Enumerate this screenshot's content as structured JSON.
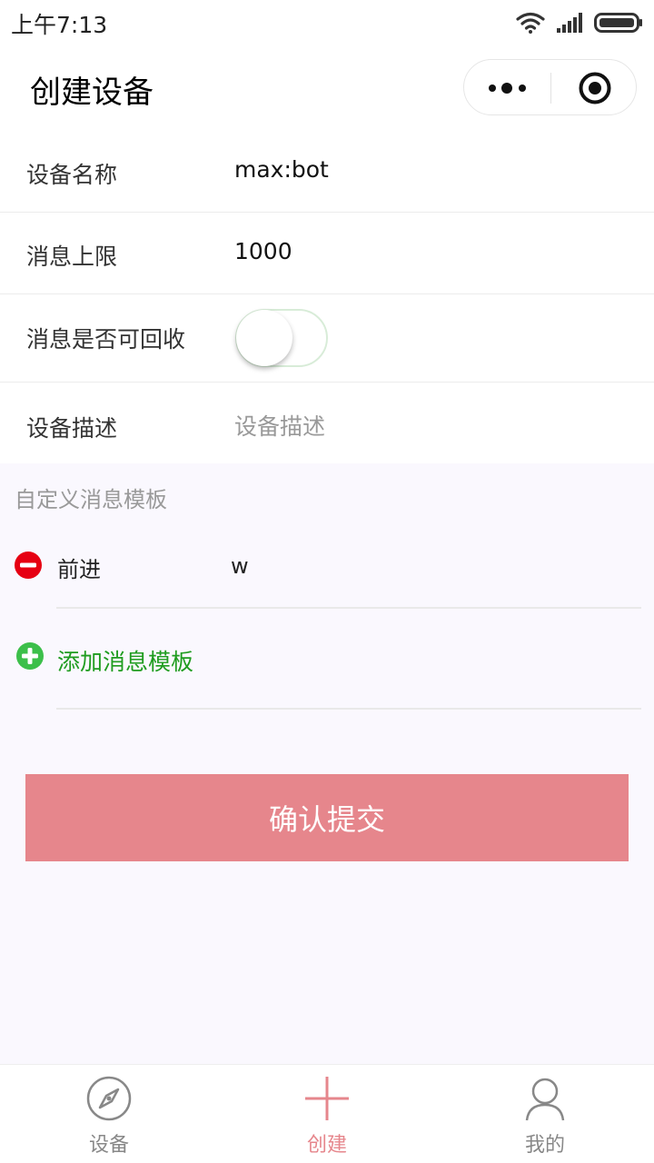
{
  "status_bar": {
    "time": "上午7:13",
    "icons": [
      "wifi-icon",
      "signal-icon",
      "battery-icon"
    ]
  },
  "nav": {
    "title": "创建设备",
    "capsule_icons": [
      "more-icon",
      "close-target-icon"
    ]
  },
  "form": {
    "device_name": {
      "label": "设备名称",
      "value": "max:bot"
    },
    "message_limit": {
      "label": "消息上限",
      "value": "1000"
    },
    "recyclable": {
      "label": "消息是否可回收",
      "on": false
    },
    "description": {
      "label": "设备描述",
      "placeholder": "设备描述"
    }
  },
  "templates": {
    "section_title": "自定义消息模板",
    "items": [
      {
        "name": "前进",
        "value": "w"
      }
    ],
    "add_label": "添加消息模板"
  },
  "submit": {
    "label": "确认提交"
  },
  "tab_bar": {
    "items": [
      {
        "label": "设备",
        "icon": "compass-icon",
        "active": false
      },
      {
        "label": "创建",
        "icon": "plus-icon",
        "active": true
      },
      {
        "label": "我的",
        "icon": "user-icon",
        "active": false
      }
    ]
  },
  "colors": {
    "accent": "#e6868c",
    "add_green": "#1f9c1f",
    "remove_red": "#e60012",
    "page_bg": "#faf8fe"
  }
}
